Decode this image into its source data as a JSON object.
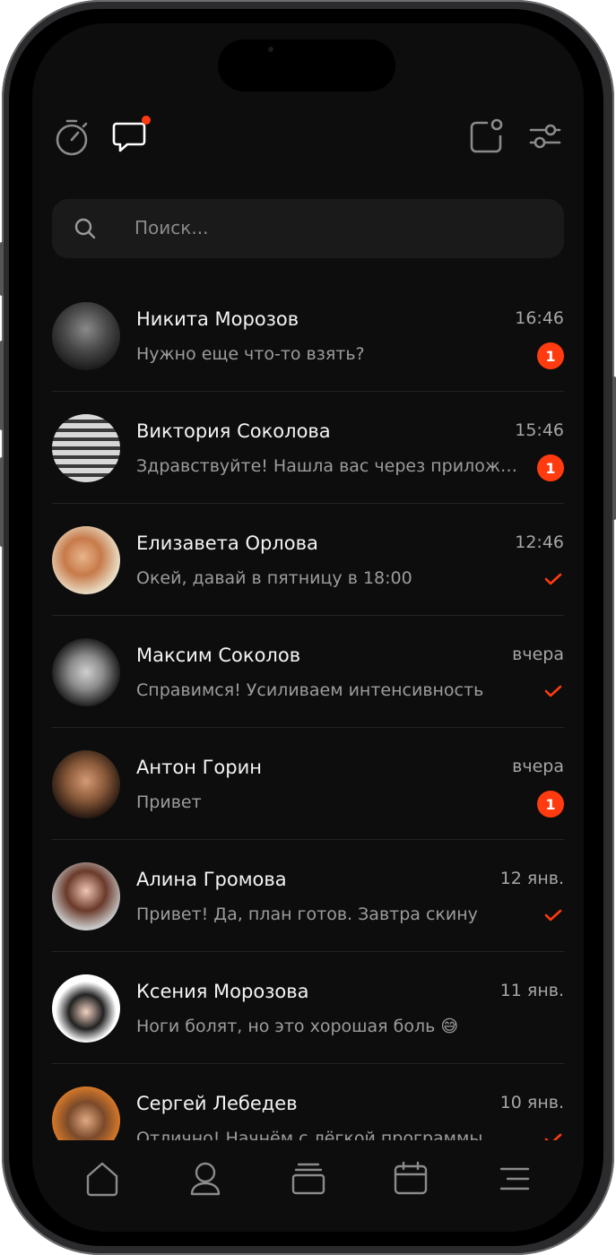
{
  "colors": {
    "accent": "#ff3b0f",
    "background": "#0d0d0d",
    "text_primary": "#f4f4f4",
    "text_secondary": "#9c9c9c"
  },
  "header": {
    "icons": [
      "stopwatch-icon",
      "chat-bubble-icon",
      "notification-square-icon",
      "filter-sliders-icon"
    ]
  },
  "search": {
    "placeholder": "Поиск..."
  },
  "chats": [
    {
      "name": "Никита Морозов",
      "preview": "Нужно еще что-то взять?",
      "time": "16:46",
      "unread": "1",
      "status": "unread"
    },
    {
      "name": "Виктория Соколова",
      "preview": "Здравствуйте! Нашла вас через приложе...",
      "time": "15:46",
      "unread": "1",
      "status": "unread"
    },
    {
      "name": "Елизавета Орлова",
      "preview": "Окей, давай в пятницу в 18:00",
      "time": "12:46",
      "status": "read"
    },
    {
      "name": "Максим Соколов",
      "preview": "Справимся! Усиливаем интенсивность",
      "time": "вчера",
      "status": "read"
    },
    {
      "name": "Антон Горин",
      "preview": "Привет",
      "time": "вчера",
      "unread": "1",
      "status": "unread"
    },
    {
      "name": "Алина Громова",
      "preview": "Привет! Да, план готов. Завтра скину",
      "time": "12 янв.",
      "status": "read"
    },
    {
      "name": "Ксения Морозова",
      "preview": "Ноги болят, но это хорошая боль 😅",
      "time": "11 янв.",
      "status": "none"
    },
    {
      "name": "Сергей Лебедев",
      "preview": "Отлично! Начнём с лёгкой программы",
      "time": "10 янв.",
      "status": "read"
    }
  ],
  "tabbar": {
    "icons": [
      "home-icon",
      "profile-icon",
      "cards-icon",
      "calendar-icon",
      "menu-icon"
    ]
  }
}
